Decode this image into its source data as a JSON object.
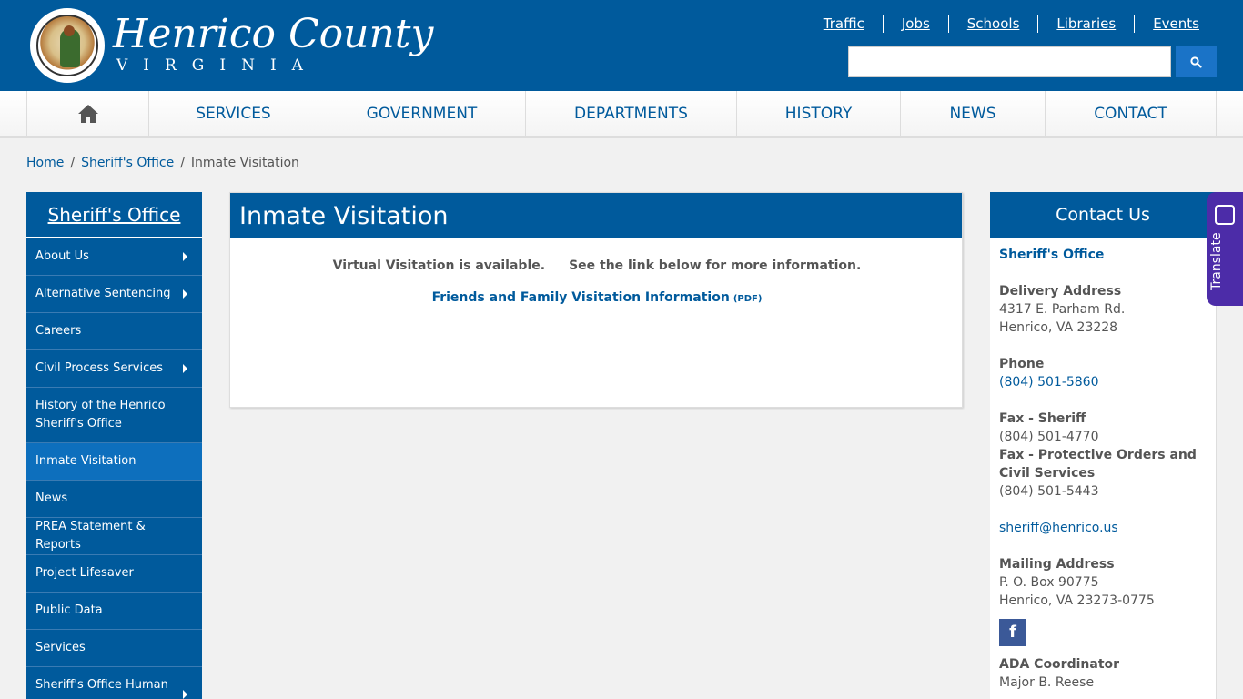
{
  "header": {
    "logo_title": "Henrico County",
    "logo_subtitle": "VIRGINIA",
    "top_links": [
      "Traffic",
      "Jobs",
      "Schools",
      "Libraries",
      "Events"
    ],
    "search_placeholder": ""
  },
  "nav": {
    "items": [
      "SERVICES",
      "GOVERNMENT",
      "DEPARTMENTS",
      "HISTORY",
      "NEWS",
      "CONTACT"
    ]
  },
  "breadcrumb": {
    "home": "Home",
    "sheriff": "Sheriff's Office",
    "current": "Inmate Visitation"
  },
  "sidebar": {
    "title": "Sheriff's Office",
    "items": [
      {
        "label": "About Us",
        "arrow": true
      },
      {
        "label": "Alternative Sentencing",
        "arrow": true
      },
      {
        "label": "Careers",
        "arrow": false
      },
      {
        "label": "Civil Process Services",
        "arrow": true
      },
      {
        "label": "History of the Henrico Sheriff's Office",
        "arrow": false
      },
      {
        "label": "Inmate Visitation",
        "arrow": false,
        "active": true
      },
      {
        "label": "News",
        "arrow": false
      },
      {
        "label": "PREA Statement & Reports",
        "arrow": false
      },
      {
        "label": "Project Lifesaver",
        "arrow": false
      },
      {
        "label": "Public Data",
        "arrow": false
      },
      {
        "label": "Services",
        "arrow": false
      },
      {
        "label": "Sheriff's Office Human",
        "arrow": true
      }
    ]
  },
  "main": {
    "title": "Inmate Visitation",
    "line1a": "Virtual Visitation is available.",
    "line1b": "See the link below for more information.",
    "link_text": "Friends and Family Visitation Information",
    "link_tag": "(PDF)"
  },
  "contact": {
    "title": "Contact Us",
    "office": "Sheriff's Office",
    "delivery_label": "Delivery Address",
    "delivery_line1": "4317 E. Parham Rd.",
    "delivery_line2": "Henrico, VA 23228",
    "phone_label": "Phone",
    "phone": "(804) 501-5860",
    "fax_sheriff_label": "Fax - Sheriff",
    "fax_sheriff": "(804) 501-4770",
    "fax_protective_label": "Fax - Protective Orders and Civil Services",
    "fax_protective": "(804) 501-5443",
    "email": "sheriff@henrico.us",
    "mailing_label": "Mailing Address",
    "mailing_line1": "P. O. Box 90775",
    "mailing_line2": "Henrico, VA 23273-0775",
    "facebook_glyph": "f",
    "ada_label": "ADA Coordinator",
    "ada_name": "Major B. Reese"
  },
  "translate": {
    "label": "Translate"
  },
  "colors": {
    "brand_blue": "#005a9c",
    "active_blue": "#0d6fbd",
    "translate_purple": "#4c2ca8"
  }
}
